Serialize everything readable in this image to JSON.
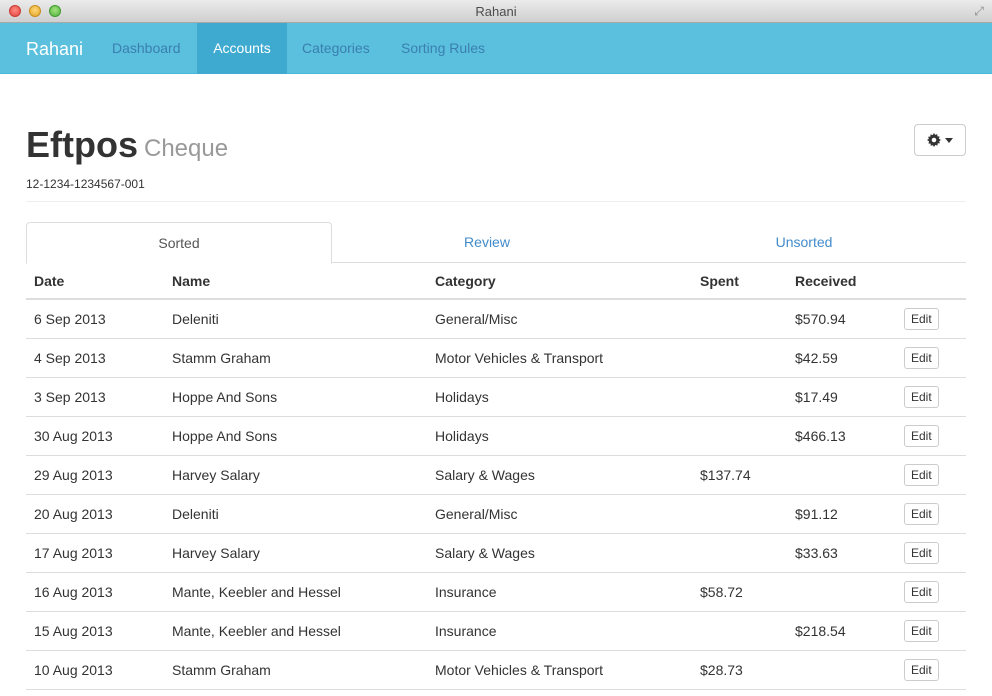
{
  "window": {
    "title": "Rahani"
  },
  "navbar": {
    "brand": "Rahani",
    "items": [
      {
        "label": "Dashboard",
        "active": false
      },
      {
        "label": "Accounts",
        "active": true
      },
      {
        "label": "Categories",
        "active": false
      },
      {
        "label": "Sorting Rules",
        "active": false
      }
    ]
  },
  "header": {
    "title": "Eftpos",
    "subtitle": "Cheque",
    "account_number": "12-1234-1234567-001"
  },
  "tabs": [
    {
      "label": "Sorted",
      "active": true
    },
    {
      "label": "Review",
      "active": false
    },
    {
      "label": "Unsorted",
      "active": false
    }
  ],
  "table": {
    "columns": [
      "Date",
      "Name",
      "Category",
      "Spent",
      "Received"
    ],
    "edit_label": "Edit",
    "rows": [
      {
        "date": "6 Sep 2013",
        "name": "Deleniti",
        "category": "General/Misc",
        "spent": "",
        "received": "$570.94"
      },
      {
        "date": "4 Sep 2013",
        "name": "Stamm Graham",
        "category": "Motor Vehicles & Transport",
        "spent": "",
        "received": "$42.59"
      },
      {
        "date": "3 Sep 2013",
        "name": "Hoppe And Sons",
        "category": "Holidays",
        "spent": "",
        "received": "$17.49"
      },
      {
        "date": "30 Aug 2013",
        "name": "Hoppe And Sons",
        "category": "Holidays",
        "spent": "",
        "received": "$466.13"
      },
      {
        "date": "29 Aug 2013",
        "name": "Harvey Salary",
        "category": "Salary & Wages",
        "spent": "$137.74",
        "received": ""
      },
      {
        "date": "20 Aug 2013",
        "name": "Deleniti",
        "category": "General/Misc",
        "spent": "",
        "received": "$91.12"
      },
      {
        "date": "17 Aug 2013",
        "name": "Harvey Salary",
        "category": "Salary & Wages",
        "spent": "",
        "received": "$33.63"
      },
      {
        "date": "16 Aug 2013",
        "name": "Mante, Keebler and Hessel",
        "category": "Insurance",
        "spent": "$58.72",
        "received": ""
      },
      {
        "date": "15 Aug 2013",
        "name": "Mante, Keebler and Hessel",
        "category": "Insurance",
        "spent": "",
        "received": "$218.54"
      },
      {
        "date": "10 Aug 2013",
        "name": "Stamm Graham",
        "category": "Motor Vehicles & Transport",
        "spent": "$28.73",
        "received": ""
      }
    ]
  },
  "icons": {
    "gear": "gear-icon",
    "caret": "caret-down-icon",
    "fullscreen": "fullscreen-icon"
  },
  "colors": {
    "navbar": "#5bc0de",
    "navbar_active": "#3faad0",
    "link": "#428bca"
  }
}
